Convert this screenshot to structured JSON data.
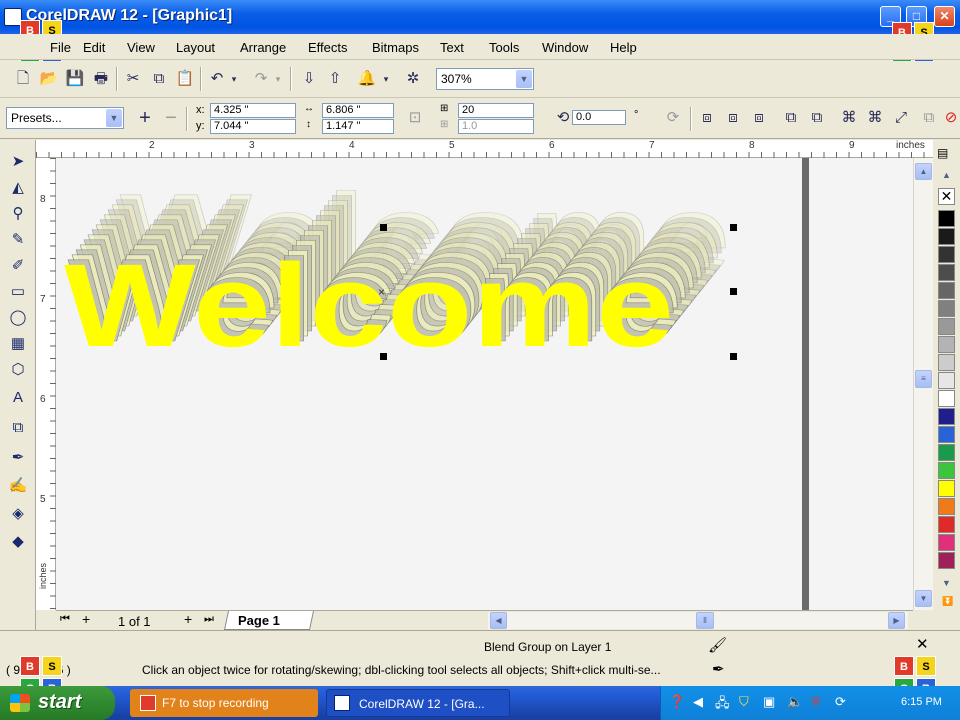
{
  "window": {
    "title": "CorelDRAW 12 - [Graphic1]",
    "min": "_",
    "max": "□",
    "close": "✕"
  },
  "badge": {
    "b": "B",
    "s": "S",
    "g": "G",
    "r": "R"
  },
  "menu": [
    "File",
    "Edit",
    "View",
    "Layout",
    "Arrange",
    "Effects",
    "Bitmaps",
    "Text",
    "Tools",
    "Window",
    "Help"
  ],
  "toolbar": {
    "zoom": "307%"
  },
  "propbar": {
    "presets": "Presets...",
    "plus": "+",
    "minus": "−",
    "x_label": "x:",
    "x_value": "4.325 \"",
    "y_label": "y:",
    "y_value": "7.044 \"",
    "w_value": "6.806 \"",
    "h_value": "1.147 \"",
    "steps": "20",
    "offset": "1.0",
    "angle": "0.0",
    "degree": "°"
  },
  "rulers": {
    "top_ticks": [
      "2",
      "3",
      "4",
      "5",
      "6",
      "7",
      "8",
      "9"
    ],
    "unit": "inches",
    "left_ticks": [
      "8",
      "7",
      "6",
      "5"
    ],
    "left_unit": "inches"
  },
  "canvas": {
    "artwork_text": "Welcome"
  },
  "pagebar": {
    "first": "⏮",
    "add": "+",
    "page_count": "1 of 1",
    "add_after": "+",
    "last": "⏭",
    "page_tab": "Page 1"
  },
  "status": {
    "object_info": "Blend Group on Layer 1",
    "coords": "( 9.      256 )",
    "hint": "Click an object twice for rotating/skewing; dbl-clicking tool selects all objects; Shift+click multi-se..."
  },
  "taskbar": {
    "start": "start",
    "task1": "F7 to stop recording",
    "task2": "CorelDRAW 12 - [Gra...",
    "clock": "6:15 PM"
  },
  "colors": {
    "title_blue": "#0054e3",
    "artwork_yellow": "#ffff00",
    "taskbar_blue": "#245edb",
    "start_green": "#2f8a2f"
  }
}
